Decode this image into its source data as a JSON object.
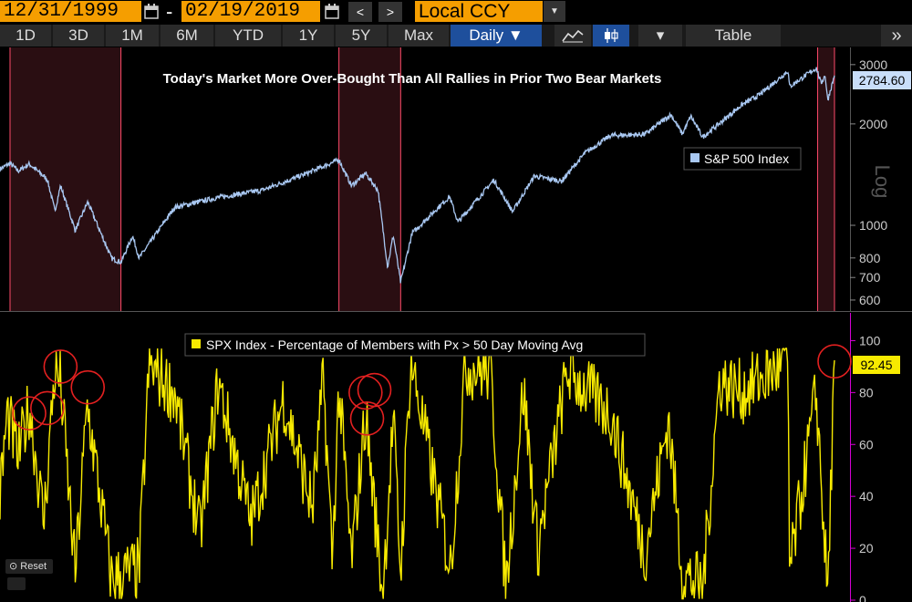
{
  "toolbar": {
    "start_date": "12/31/1999",
    "separator": "-",
    "end_date": "02/19/2019",
    "prev": "<",
    "next": ">",
    "currency": "Local CCY",
    "currency_caret": "▼"
  },
  "tabs": {
    "t1d": "1D",
    "t3d": "3D",
    "t1m": "1M",
    "t6m": "6M",
    "tytd": "YTD",
    "t1y": "1Y",
    "t5y": "5Y",
    "tmax": "Max",
    "daily": "Daily ▼",
    "dropdown": "▾",
    "table": "Table",
    "expand": "»"
  },
  "colors": {
    "accent_orange": "#f59e00",
    "spx_line": "#a9c8f2",
    "breadth_line": "#f7ea00",
    "bear_shade": "#2a0e12",
    "bear_border": "#ff4a6a",
    "axis_magenta": "#d400d4",
    "circle_red": "#e32020",
    "active_tab": "#1e4f9c"
  },
  "controls": {
    "reset": "Reset"
  },
  "chart_data": [
    {
      "type": "line",
      "title": "Today's Market More Over-Bought Than All Rallies in Prior Two Bear Markets",
      "series": [
        {
          "name": "S&P 500 Index",
          "x": [
            "1999-12-31",
            "2000-03-24",
            "2000-06-01",
            "2000-09-01",
            "2001-01-30",
            "2001-04-04",
            "2001-05-21",
            "2001-09-21",
            "2002-01-04",
            "2002-07-23",
            "2002-10-09",
            "2003-01-14",
            "2003-03-11",
            "2004-01-01",
            "2005-01-01",
            "2006-01-01",
            "2007-01-01",
            "2007-10-09",
            "2008-01-22",
            "2008-05-19",
            "2008-09-01",
            "2008-11-20",
            "2009-01-06",
            "2009-03-09",
            "2009-06-12",
            "2010-01-01",
            "2010-04-23",
            "2010-07-02",
            "2011-04-29",
            "2011-10-03",
            "2012-04-01",
            "2012-11-15",
            "2013-06-01",
            "2014-01-01",
            "2014-10-15",
            "2015-05-21",
            "2015-08-25",
            "2015-11-03",
            "2016-02-11",
            "2016-06-27",
            "2017-01-01",
            "2017-06-01",
            "2018-01-26",
            "2018-02-08",
            "2018-09-20",
            "2018-10-29",
            "2018-12-03",
            "2018-12-24",
            "2019-02-19"
          ],
          "values": [
            1469,
            1527,
            1450,
            1520,
            1370,
            1103,
            1312,
            966,
            1172,
            797,
            777,
            930,
            800,
            1130,
            1210,
            1270,
            1420,
            1565,
            1310,
            1426,
            1270,
            752,
            935,
            677,
            946,
            1115,
            1217,
            1022,
            1363,
            1099,
            1400,
            1353,
            1640,
            1848,
            1862,
            2131,
            1867,
            2109,
            1829,
            2000,
            2275,
            2440,
            2873,
            2581,
            2930,
            2641,
            2790,
            2351,
            2784.6
          ],
          "last_label": "2784.60"
        },
        {
          "name": "SPX Index - Percentage of Members with Px > 50 Day Moving Avg",
          "x": [
            "1999-12-31",
            "2000-03-01",
            "2000-06-01",
            "2000-09-01",
            "2001-01-01",
            "2001-04-01",
            "2001-05-21",
            "2001-09-21",
            "2002-01-01",
            "2002-07-23",
            "2003-03-11",
            "2003-06-01",
            "2004-01-01",
            "2004-08-01",
            "2005-01-01",
            "2005-10-01",
            "2006-07-01",
            "2007-03-01",
            "2007-06-01",
            "2007-08-15",
            "2007-10-09",
            "2008-01-22",
            "2008-05-19",
            "2008-10-10",
            "2009-01-06",
            "2009-03-09",
            "2009-06-01",
            "2010-05-01",
            "2010-09-01",
            "2011-04-01",
            "2011-08-08",
            "2012-01-01",
            "2012-05-01",
            "2013-01-01",
            "2014-01-01",
            "2014-10-15",
            "2015-05-01",
            "2015-08-25",
            "2016-02-11",
            "2016-07-01",
            "2017-01-01",
            "2018-01-26",
            "2018-02-08",
            "2018-09-20",
            "2018-12-24",
            "2019-02-19"
          ],
          "values": [
            40,
            72,
            55,
            75,
            30,
            88,
            84,
            10,
            75,
            8,
            12,
            90,
            80,
            25,
            84,
            30,
            78,
            35,
            85,
            15,
            82,
            15,
            72,
            2,
            70,
            10,
            93,
            12,
            90,
            88,
            5,
            82,
            20,
            88,
            72,
            18,
            70,
            10,
            5,
            85,
            80,
            92,
            10,
            80,
            1,
            92.45
          ],
          "last_label": "92.45"
        }
      ],
      "bear_markets": [
        [
          "2000-03-24",
          "2002-10-09"
        ],
        [
          "2007-10-09",
          "2009-03-09"
        ],
        [
          "2018-10-01",
          "2019-02-19"
        ]
      ],
      "highlighted_rallies": [
        "2000-09-01",
        "2001-01-30",
        "2001-05-21",
        "2002-01-04",
        "2008-05-19",
        "2008-06-01",
        "2008-08-01",
        "2019-02-19"
      ],
      "y_axis_top": {
        "scale": "log",
        "label": "Log",
        "ticks": [
          600,
          700,
          800,
          1000,
          2000,
          3000
        ],
        "range": [
          560,
          3250
        ]
      },
      "y_axis_bottom": {
        "ticks": [
          0,
          20,
          40,
          60,
          80,
          100
        ],
        "range": [
          0,
          110
        ]
      },
      "x_range": [
        "1999-12-31",
        "2019-02-19"
      ]
    }
  ]
}
